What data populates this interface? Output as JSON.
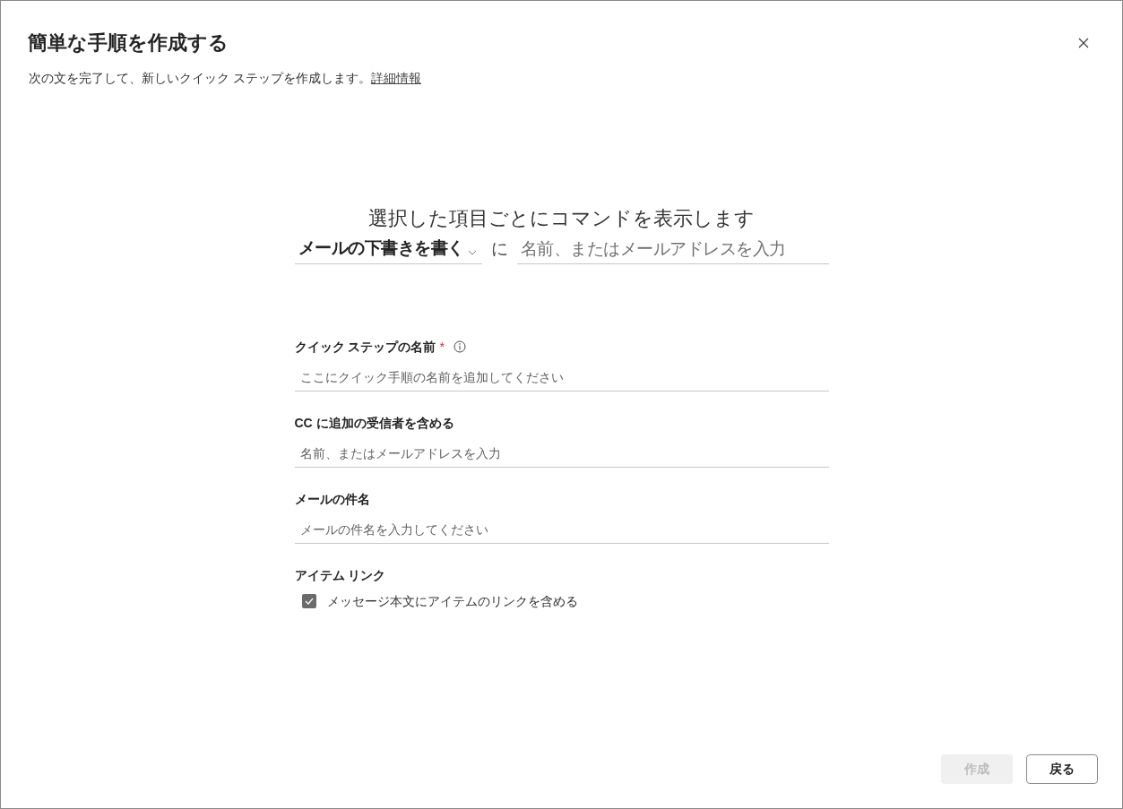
{
  "dialog": {
    "title": "簡単な手順を作成する",
    "subtitle": "次の文を完了して、新しいクイック ステップを作成します。",
    "learn_more_link": "詳細情報"
  },
  "command": {
    "heading": "選択した項目ごとにコマンドを表示します",
    "action": "メールの下書きを書く",
    "connector": "に",
    "recipient_placeholder": "名前、またはメールアドレスを入力"
  },
  "fields": [
    {
      "kind": "text",
      "label": "クイック ステップの名前",
      "required_mark": "*",
      "info": true,
      "placeholder": "ここにクイック手順の名前を追加してください"
    },
    {
      "kind": "text",
      "label": "CC に追加の受信者を含める",
      "placeholder": "名前、またはメールアドレスを入力"
    },
    {
      "kind": "text",
      "label": "メールの件名",
      "placeholder": "メールの件名を入力してください"
    },
    {
      "kind": "checkbox",
      "label": "アイテム リンク",
      "option": "メッセージ本文にアイテムのリンクを含める",
      "checked": true
    }
  ],
  "buttons": [
    {
      "label": "作成",
      "disabled": true
    },
    {
      "label": "戻る",
      "disabled": false
    }
  ]
}
